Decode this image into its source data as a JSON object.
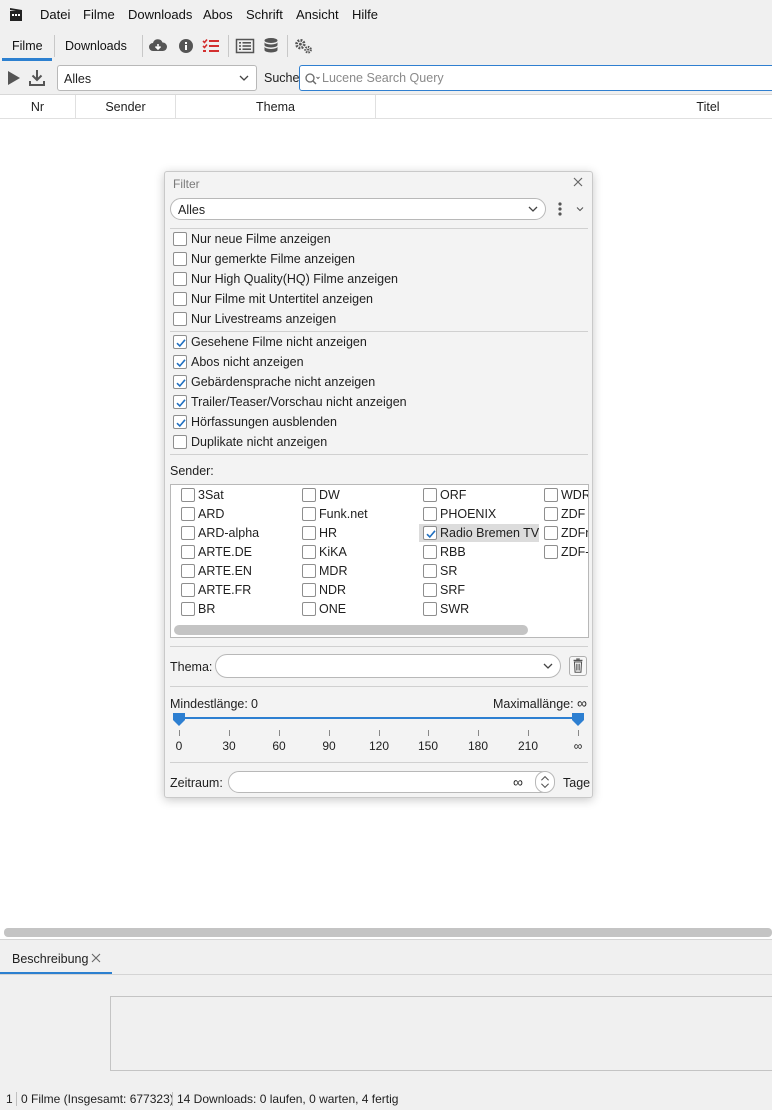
{
  "menubar": {
    "items": [
      "Datei",
      "Filme",
      "Downloads",
      "Abos",
      "Schrift",
      "Ansicht",
      "Hilfe"
    ]
  },
  "toolbar": {
    "tabs": [
      "Filme",
      "Downloads"
    ],
    "active_tab": "Filme",
    "icons": [
      "cloud-download-icon",
      "info-icon",
      "checklist-icon",
      "list-view-icon",
      "database-icon",
      "settings-gears-icon"
    ],
    "accent_color": "#2c80d0",
    "checklist_color": "#d32f2f"
  },
  "searchrow": {
    "filter_value": "Alles",
    "search_label": "Suche:",
    "search_placeholder": "Lucene Search Query",
    "search_value": ""
  },
  "table": {
    "columns": [
      "Nr",
      "Sender",
      "Thema",
      "Titel"
    ],
    "rows": []
  },
  "filter_dialog": {
    "title": "Filter",
    "preset": "Alles",
    "options_group1": [
      {
        "label": "Nur neue Filme anzeigen",
        "checked": false
      },
      {
        "label": "Nur gemerkte Filme anzeigen",
        "checked": false
      },
      {
        "label": "Nur High Quality(HQ) Filme anzeigen",
        "checked": false
      },
      {
        "label": "Nur Filme mit Untertitel anzeigen",
        "checked": false
      },
      {
        "label": "Nur Livestreams anzeigen",
        "checked": false
      }
    ],
    "options_group2": [
      {
        "label": "Gesehene Filme nicht anzeigen",
        "checked": true
      },
      {
        "label": "Abos nicht anzeigen",
        "checked": true
      },
      {
        "label": "Gebärdensprache nicht anzeigen",
        "checked": true
      },
      {
        "label": "Trailer/Teaser/Vorschau nicht anzeigen",
        "checked": true
      },
      {
        "label": "Hörfassungen ausblenden",
        "checked": true
      },
      {
        "label": "Duplikate nicht anzeigen",
        "checked": false
      }
    ],
    "sender_label": "Sender:",
    "sender_columns": [
      [
        {
          "label": "3Sat",
          "checked": false
        },
        {
          "label": "ARD",
          "checked": false
        },
        {
          "label": "ARD-alpha",
          "checked": false
        },
        {
          "label": "ARTE.DE",
          "checked": false
        },
        {
          "label": "ARTE.EN",
          "checked": false
        },
        {
          "label": "ARTE.FR",
          "checked": false
        },
        {
          "label": "BR",
          "checked": false
        }
      ],
      [
        {
          "label": "DW",
          "checked": false
        },
        {
          "label": "Funk.net",
          "checked": false
        },
        {
          "label": "HR",
          "checked": false
        },
        {
          "label": "KiKA",
          "checked": false
        },
        {
          "label": "MDR",
          "checked": false
        },
        {
          "label": "NDR",
          "checked": false
        },
        {
          "label": "ONE",
          "checked": false
        }
      ],
      [
        {
          "label": "ORF",
          "checked": false
        },
        {
          "label": "PHOENIX",
          "checked": false
        },
        {
          "label": "Radio Bremen TV",
          "checked": true
        },
        {
          "label": "RBB",
          "checked": false
        },
        {
          "label": "SR",
          "checked": false
        },
        {
          "label": "SRF",
          "checked": false
        },
        {
          "label": "SWR",
          "checked": false
        }
      ],
      [
        {
          "label": "WDR",
          "checked": false
        },
        {
          "label": "ZDF",
          "checked": false
        },
        {
          "label": "ZDFn",
          "checked": false
        },
        {
          "label": "ZDF-t",
          "checked": false
        }
      ]
    ],
    "thema_label": "Thema:",
    "thema_value": "",
    "mindest_label": "Mindestlänge:",
    "mindest_value": "0",
    "maxlen_label": "Maximallänge:",
    "maxlen_value": "∞",
    "slider_ticks": [
      "0",
      "30",
      "60",
      "90",
      "120",
      "150",
      "180",
      "210",
      "∞"
    ],
    "slider_min_fraction": 0,
    "slider_max_fraction": 1,
    "zeitraum_label": "Zeitraum:",
    "zeitraum_value": "∞",
    "tage_label": "Tage"
  },
  "description": {
    "tab_label": "Beschreibung",
    "text": ""
  },
  "statusbar": {
    "selected": "1",
    "filme": "0 Filme (Insgesamt: 677323)",
    "downloads": "14 Downloads: 0 laufen, 0 warten, 4 fertig"
  }
}
